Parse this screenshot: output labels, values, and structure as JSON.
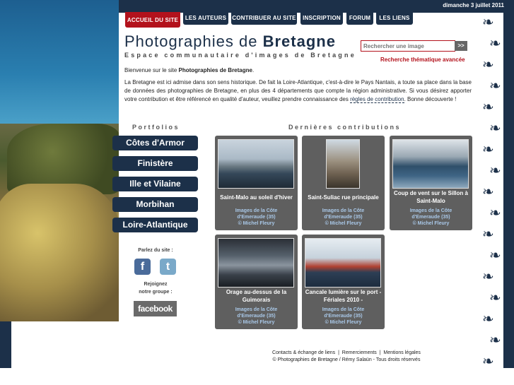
{
  "header": {
    "date": "dimanche 3 juillet 2011",
    "title_normal": "Photographies de",
    "title_bold": "Bretagne",
    "subtitle": "Espace communautaire d'images de Bretagne"
  },
  "nav": [
    "ACCUEIL DU SITE",
    "LES AUTEURS",
    "CONTRIBUER AU SITE",
    "INSCRIPTION",
    "FORUM",
    "LES LIENS"
  ],
  "search": {
    "placeholder": "Rechercher une image",
    "button": ">>",
    "advanced": "Recherche thématique avancée"
  },
  "intro": {
    "welcome_prefix": "Bienvenue sur le site ",
    "welcome_bold": "Photographies de Bretagne",
    "welcome_suffix": ".",
    "para": "La Bretagne est ici admise dans son sens historique. De fait la Loire-Atlantique, c'est-à-dire le Pays Nantais, a toute sa place dans la base de données des photographies de Bretagne, en plus des 4 départements que compte la région administrative.",
    "contrib_prefix": "Si vous désirez apporter votre contribution et être référencé en qualité d'auteur, veuillez prendre connaissance des ",
    "contrib_link": "règles de contribution",
    "contrib_suffix": ". Bonne découverte !"
  },
  "sections": {
    "portfolios": "Portfolios",
    "latest": "Dernières contributions"
  },
  "portfolios": [
    "Côtes d'Armor",
    "Finistère",
    "Ille et Vilaine",
    "Morbihan",
    "Loire-Atlantique"
  ],
  "social": {
    "talk": "Parlez du site :",
    "facebook_icon": "f",
    "twitter_icon": "t",
    "join_line1": "Rejoignez",
    "join_line2": "notre groupe :",
    "facebook_label": "facebook"
  },
  "contributions": [
    {
      "title": "Saint-Malo au soleil d'hiver",
      "credit1": "Images de la Côte",
      "credit2": "d'Emeraude (35)",
      "credit3": "© Michel Fleury"
    },
    {
      "title": "Saint-Suliac rue principale",
      "credit1": "Images de la Côte",
      "credit2": "d'Emeraude (35)",
      "credit3": "© Michel Fleury"
    },
    {
      "title": "Coup de vent sur le Sillon à Saint-Malo",
      "credit1": "Images de la Côte",
      "credit2": "d'Emeraude (35)",
      "credit3": "© Michel Fleury"
    },
    {
      "title": "Orage au-dessus de la Guimorais",
      "credit1": "Images de la Côte",
      "credit2": "d'Emeraude (35)",
      "credit3": "© Michel Fleury"
    },
    {
      "title": "Cancale lumière sur le port - Fériales 2010 -",
      "credit1": "Images de la Côte",
      "credit2": "d'Emeraude (35)",
      "credit3": "© Michel Fleury"
    }
  ],
  "footer": {
    "link1": "Contacts & échange de liens",
    "sep": "|",
    "link2": "Remerciements",
    "link3": "Mentions légales",
    "copyright": "© Photographies de Bretagne / Rémy Salaün - Tous droits réservés"
  },
  "colors": {
    "navy": "#1c3049",
    "accent_red": "#b3121c",
    "card_gray": "#5f5f5f"
  }
}
